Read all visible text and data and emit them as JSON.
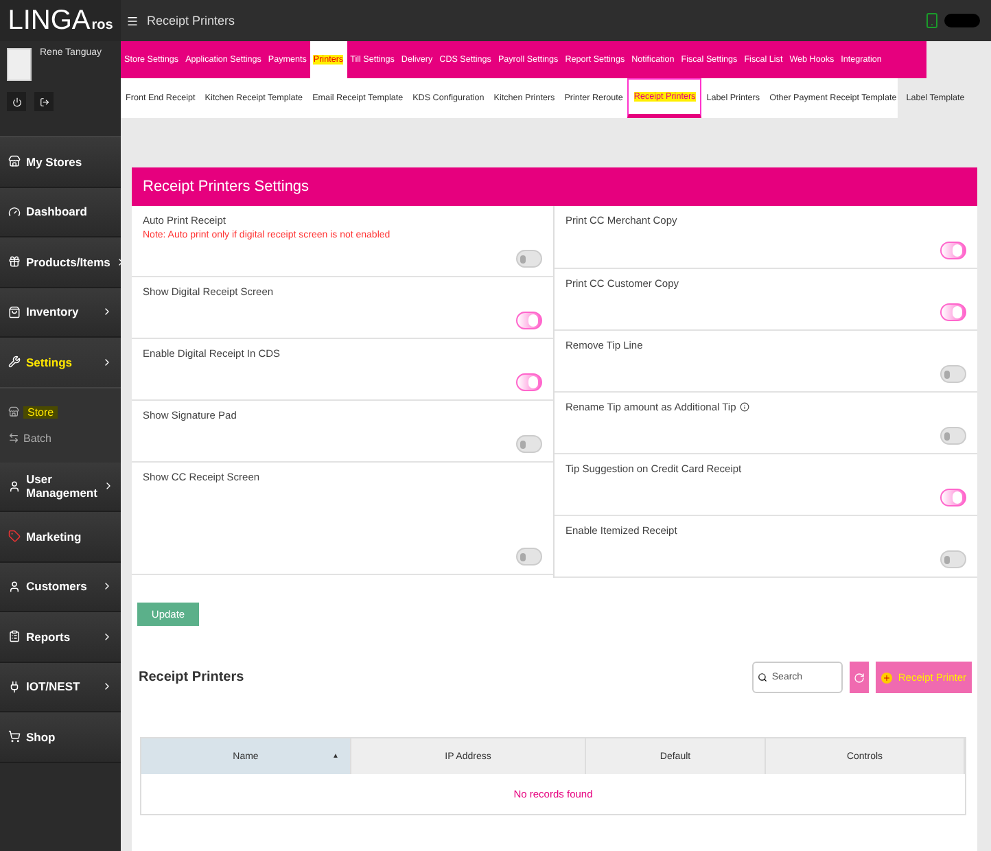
{
  "header": {
    "logo_main": "LINGA",
    "logo_sub": "ros",
    "page_title": "Receipt Printers"
  },
  "profile": {
    "name": "Rene Tanguay"
  },
  "sidebar": {
    "items": [
      {
        "label": "My Stores",
        "chevron": false,
        "highlighted": false
      },
      {
        "label": "Dashboard",
        "chevron": false,
        "highlighted": false
      },
      {
        "label": "Products/Items",
        "chevron": true,
        "highlighted": false
      },
      {
        "label": "Inventory",
        "chevron": true,
        "highlighted": false
      },
      {
        "label": "Settings",
        "chevron": true,
        "highlighted": true,
        "expanded": true,
        "children": [
          {
            "label": "Store",
            "highlighted": true
          },
          {
            "label": "Batch",
            "highlighted": false
          }
        ]
      },
      {
        "label": "User Management",
        "chevron": true,
        "highlighted": false
      },
      {
        "label": "Marketing",
        "chevron": false,
        "highlighted": false
      },
      {
        "label": "Customers",
        "chevron": true,
        "highlighted": false
      },
      {
        "label": "Reports",
        "chevron": true,
        "highlighted": false
      },
      {
        "label": "IOT/NEST",
        "chevron": true,
        "highlighted": false
      },
      {
        "label": "Shop",
        "chevron": false,
        "highlighted": false
      }
    ]
  },
  "top_tabs": [
    {
      "label": "Store Settings",
      "selected": false,
      "highlighted": false
    },
    {
      "label": "Application Settings",
      "selected": false,
      "highlighted": false
    },
    {
      "label": "Payments",
      "selected": false,
      "highlighted": false
    },
    {
      "label": "Printers",
      "selected": true,
      "highlighted": true
    },
    {
      "label": "Till Settings",
      "selected": false,
      "highlighted": false
    },
    {
      "label": "Delivery",
      "selected": false,
      "highlighted": false
    },
    {
      "label": "CDS Settings",
      "selected": false,
      "highlighted": false
    },
    {
      "label": "Payroll Settings",
      "selected": false,
      "highlighted": false
    },
    {
      "label": "Report Settings",
      "selected": false,
      "highlighted": false
    },
    {
      "label": "Notification",
      "selected": false,
      "highlighted": false
    },
    {
      "label": "Fiscal Settings",
      "selected": false,
      "highlighted": false
    },
    {
      "label": "Fiscal List",
      "selected": false,
      "highlighted": false
    },
    {
      "label": "Web Hooks",
      "selected": false,
      "highlighted": false
    },
    {
      "label": "Integration",
      "selected": false,
      "highlighted": false
    }
  ],
  "sub_tabs": [
    {
      "label": "Front End Receipt",
      "selected": false,
      "highlighted": false
    },
    {
      "label": "Kitchen Receipt Template",
      "selected": false,
      "highlighted": false
    },
    {
      "label": "Email Receipt Template",
      "selected": false,
      "highlighted": false
    },
    {
      "label": "KDS Configuration",
      "selected": false,
      "highlighted": false
    },
    {
      "label": "Kitchen Printers",
      "selected": false,
      "highlighted": false
    },
    {
      "label": "Printer Reroute",
      "selected": false,
      "highlighted": false
    },
    {
      "label": "Receipt Printers",
      "selected": true,
      "highlighted": true
    },
    {
      "label": "Label Printers",
      "selected": false,
      "highlighted": false
    },
    {
      "label": "Other Payment Receipt Template",
      "selected": false,
      "highlighted": false
    },
    {
      "label": "Label Template",
      "selected": false,
      "highlighted": false
    }
  ],
  "settings": {
    "title": "Receipt Printers Settings",
    "left": [
      {
        "label": "Auto Print Receipt",
        "note": "Note: Auto print only if digital receipt screen is not enabled",
        "on": false
      },
      {
        "label": "Show Digital Receipt Screen",
        "on": true
      },
      {
        "label": "Enable Digital Receipt In CDS",
        "on": true
      },
      {
        "label": "Show Signature Pad",
        "on": false
      },
      {
        "label": "Show CC Receipt Screen",
        "on": false
      }
    ],
    "right": [
      {
        "label": "Print CC Merchant Copy",
        "on": true
      },
      {
        "label": "Print CC Customer Copy",
        "on": true
      },
      {
        "label": "Remove Tip Line",
        "on": false
      },
      {
        "label": "Rename Tip amount as Additional Tip",
        "info": true,
        "on": false
      },
      {
        "label": "Tip Suggestion on Credit Card Receipt",
        "on": true
      },
      {
        "label": "Enable Itemized Receipt",
        "on": false
      }
    ],
    "update_button": "Update"
  },
  "printers": {
    "title": "Receipt Printers",
    "search": {
      "placeholder": "Search"
    },
    "add_button": "Receipt Printer",
    "table": {
      "columns": [
        "Name",
        "IP Address",
        "Default",
        "Controls"
      ],
      "sort_indicator": "▲",
      "empty_message": "No records found"
    }
  }
}
